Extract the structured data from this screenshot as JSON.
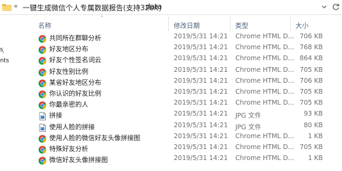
{
  "address": {
    "parent": "一键生成微信个人专属数据报告(支持32bit)",
    "current": "data",
    "nav_back_chevrons": "«",
    "separator": "›"
  },
  "nav_pane": {
    "items": [
      "s",
      "nts"
    ]
  },
  "columns": {
    "name": "名称",
    "date": "修改日期",
    "type": "类型",
    "size": "大小"
  },
  "files": [
    {
      "name": "共同所在群聊分析",
      "date": "2019/5/31 14:21",
      "type": "Chrome HTML D...",
      "size": "706 KB",
      "icon": "chrome-icon"
    },
    {
      "name": "好友地区分布",
      "date": "2019/5/31 14:21",
      "type": "Chrome HTML D...",
      "size": "768 KB",
      "icon": "chrome-icon"
    },
    {
      "name": "好友个性签名词云",
      "date": "2019/5/31 14:21",
      "type": "Chrome HTML D...",
      "size": "864 KB",
      "icon": "chrome-icon"
    },
    {
      "name": "好友性别比例",
      "date": "2019/5/31 14:21",
      "type": "Chrome HTML D...",
      "size": "705 KB",
      "icon": "chrome-icon"
    },
    {
      "name": "某省好友地区分布",
      "date": "2019/5/31 14:21",
      "type": "Chrome HTML D...",
      "size": "706 KB",
      "icon": "chrome-icon"
    },
    {
      "name": "你认识的好友比例",
      "date": "2019/5/31 14:21",
      "type": "Chrome HTML D...",
      "size": "705 KB",
      "icon": "chrome-icon"
    },
    {
      "name": "你最亲密的人",
      "date": "2019/5/31 14:21",
      "type": "Chrome HTML D...",
      "size": "705 KB",
      "icon": "chrome-icon"
    },
    {
      "name": "拼接",
      "date": "2019/5/31 14:21",
      "type": "JPG 文件",
      "size": "93 KB",
      "icon": "jpg-icon"
    },
    {
      "name": "使用人脸的拼接",
      "date": "2019/5/31 14:21",
      "type": "JPG 文件",
      "size": "80 KB",
      "icon": "jpg-icon"
    },
    {
      "name": "使用人脸的微信好友头像拼接图",
      "date": "2019/5/31 14:21",
      "type": "Chrome HTML D...",
      "size": "1 KB",
      "icon": "chrome-icon"
    },
    {
      "name": "特殊好友分析",
      "date": "2019/5/31 14:21",
      "type": "Chrome HTML D...",
      "size": "705 KB",
      "icon": "chrome-icon"
    },
    {
      "name": "微信好友头像拼接图",
      "date": "2019/5/31 14:21",
      "type": "Chrome HTML D...",
      "size": "1 KB",
      "icon": "chrome-icon"
    }
  ],
  "colors": {
    "chrome_red": "#db4437",
    "chrome_green": "#0f9d58",
    "chrome_yellow": "#f4b400",
    "chrome_blue": "#4285f4",
    "folder_yellow": "#f8d775",
    "header_text": "#4c607a"
  }
}
